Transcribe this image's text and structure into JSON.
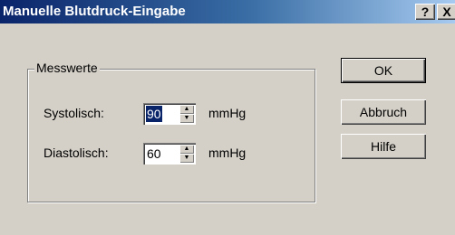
{
  "window": {
    "title": "Manuelle Blutdruck-Eingabe",
    "help_label": "?",
    "close_label": "X"
  },
  "group": {
    "label": "Messwerte",
    "fields": [
      {
        "label": "Systolisch:",
        "value": "90",
        "unit": "mmHg"
      },
      {
        "label": "Diastolisch:",
        "value": "60",
        "unit": "mmHg"
      }
    ]
  },
  "buttons": {
    "ok": "OK",
    "cancel": "Abbruch",
    "help": "Hilfe"
  },
  "icons": {
    "spin_up": "spin-up-icon",
    "spin_down": "spin-down-icon"
  },
  "colors": {
    "titlebar": "#0a246a",
    "face": "#d4d0c8",
    "selection": "#0a246a"
  }
}
